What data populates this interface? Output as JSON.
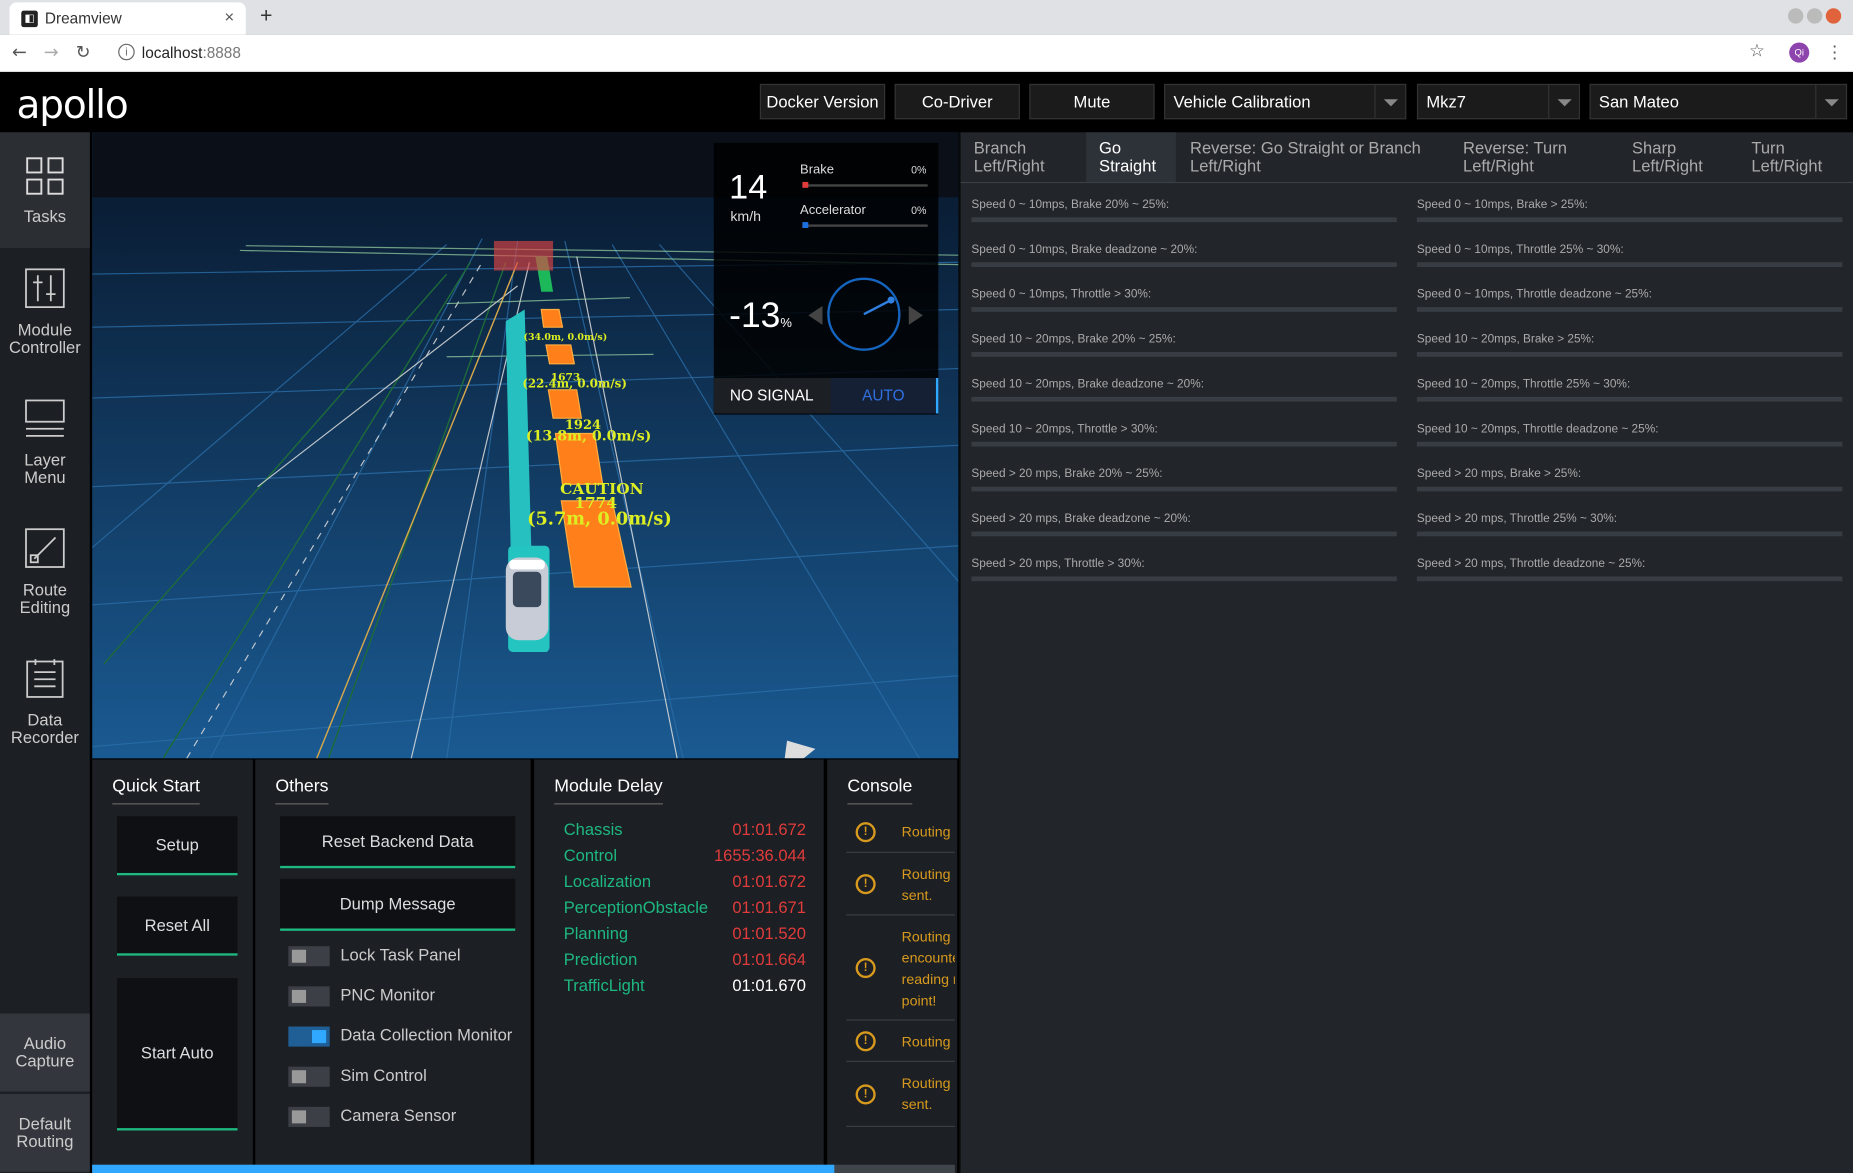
{
  "browser": {
    "tab_title": "Dreamview",
    "tab_close": "×",
    "new_tab": "+",
    "url_host": "localhost",
    "url_port": ":8888",
    "back": "←",
    "forward": "→",
    "reload": "↻",
    "info": "i",
    "star": "☆",
    "avatar_initials": "Qi",
    "menu": "⋮"
  },
  "header": {
    "logo": "apollo",
    "docker_version": "Docker Version",
    "co_driver": "Co-Driver",
    "mute": "Mute",
    "mode_select": "Vehicle Calibration",
    "vehicle_select": "Mkz7",
    "map_select": "San Mateo"
  },
  "sidenav": {
    "tasks": "Tasks",
    "module_controller": [
      "Module",
      "Controller"
    ],
    "layer_menu": [
      "Layer",
      "Menu"
    ],
    "route_editing": [
      "Route",
      "Editing"
    ],
    "data_recorder": [
      "Data",
      "Recorder"
    ],
    "audio_capture": [
      "Audio",
      "Capture"
    ],
    "default_routing": [
      "Default",
      "Routing"
    ]
  },
  "dashboard": {
    "speed": "14",
    "speed_unit": "km/h",
    "brake_label": "Brake",
    "brake_pct": "0%",
    "accel_label": "Accelerator",
    "accel_pct": "0%",
    "steering": "-13",
    "steering_unit": "%",
    "signal": "NO SIGNAL",
    "drive_mode": "AUTO",
    "brake_color": "#e03c3c",
    "accel_color": "#1e6fe0"
  },
  "scene_labels": {
    "obstacle_a": "(34.0m, 0.0m/s)",
    "obstacle_b_id": "1673",
    "obstacle_b": "(22.4m, 0.0m/s)",
    "obstacle_c_id": "1924",
    "obstacle_c": "(13.8m, 0.0m/s)",
    "caution": "CAUTION",
    "obstacle_d_id": "1774",
    "obstacle_d": "(5.7m, 0.0m/s)"
  },
  "calibration": {
    "tabs": [
      [
        "Branch",
        "Left/Right"
      ],
      [
        "Go",
        "Straight"
      ],
      [
        "Reverse: Go Straight or Branch",
        "Left/Right"
      ],
      [
        "Reverse: Turn",
        "Left/Right"
      ],
      [
        "Sharp",
        "Left/Right"
      ],
      [
        "Turn",
        "Left/Right"
      ]
    ],
    "left_items": [
      "Speed 0 ~ 10mps, Brake 20% ~ 25%:",
      "Speed 0 ~ 10mps, Brake deadzone ~ 20%:",
      "Speed 0 ~ 10mps, Throttle > 30%:",
      "Speed 10 ~ 20mps, Brake 20% ~ 25%:",
      "Speed 10 ~ 20mps, Brake deadzone ~ 20%:",
      "Speed 10 ~ 20mps, Throttle > 30%:",
      "Speed > 20 mps, Brake 20% ~ 25%:",
      "Speed > 20 mps, Brake deadzone ~ 20%:",
      "Speed > 20 mps, Throttle > 30%:"
    ],
    "right_items": [
      "Speed 0 ~ 10mps, Brake > 25%:",
      "Speed 0 ~ 10mps, Throttle 25% ~ 30%:",
      "Speed 0 ~ 10mps, Throttle deadzone ~ 25%:",
      "Speed 10 ~ 20mps, Brake > 25%:",
      "Speed 10 ~ 20mps, Throttle 25% ~ 30%:",
      "Speed 10 ~ 20mps, Throttle deadzone ~ 25%:",
      "Speed > 20 mps, Brake > 25%:",
      "Speed > 20 mps, Throttle 25% ~ 30%:",
      "Speed > 20 mps, Throttle deadzone ~ 25%:"
    ]
  },
  "quick_start": {
    "title": "Quick Start",
    "setup": "Setup",
    "reset_all": "Reset All",
    "start_auto": "Start Auto"
  },
  "others": {
    "title": "Others",
    "reset_backend": "Reset Backend Data",
    "dump_message": "Dump Message",
    "toggles": [
      {
        "label": "Lock Task Panel",
        "on": false
      },
      {
        "label": "PNC Monitor",
        "on": false
      },
      {
        "label": "Data Collection Monitor",
        "on": true
      },
      {
        "label": "Sim Control",
        "on": false
      },
      {
        "label": "Camera Sensor",
        "on": false
      }
    ]
  },
  "module_delay": {
    "title": "Module Delay",
    "rows": [
      {
        "name": "Chassis",
        "value": "01:01.672",
        "ok": false
      },
      {
        "name": "Control",
        "value": "1655:36.044",
        "ok": false
      },
      {
        "name": "Localization",
        "value": "01:01.672",
        "ok": false
      },
      {
        "name": "PerceptionObstacle",
        "value": "01:01.671",
        "ok": false
      },
      {
        "name": "Planning",
        "value": "01:01.520",
        "ok": false
      },
      {
        "name": "Prediction",
        "value": "01:01.664",
        "ok": false
      },
      {
        "name": "TrafficLight",
        "value": "01:01.670",
        "ok": true
      }
    ]
  },
  "console": {
    "title": "Console",
    "icon": "!",
    "messages": [
      [
        "Routing"
      ],
      [
        "Routing",
        "sent."
      ],
      [
        "Routing",
        "encounte",
        "reading r",
        "point!"
      ],
      [
        "Routing"
      ],
      [
        "Routing",
        "sent."
      ]
    ]
  },
  "progress": 0.86
}
